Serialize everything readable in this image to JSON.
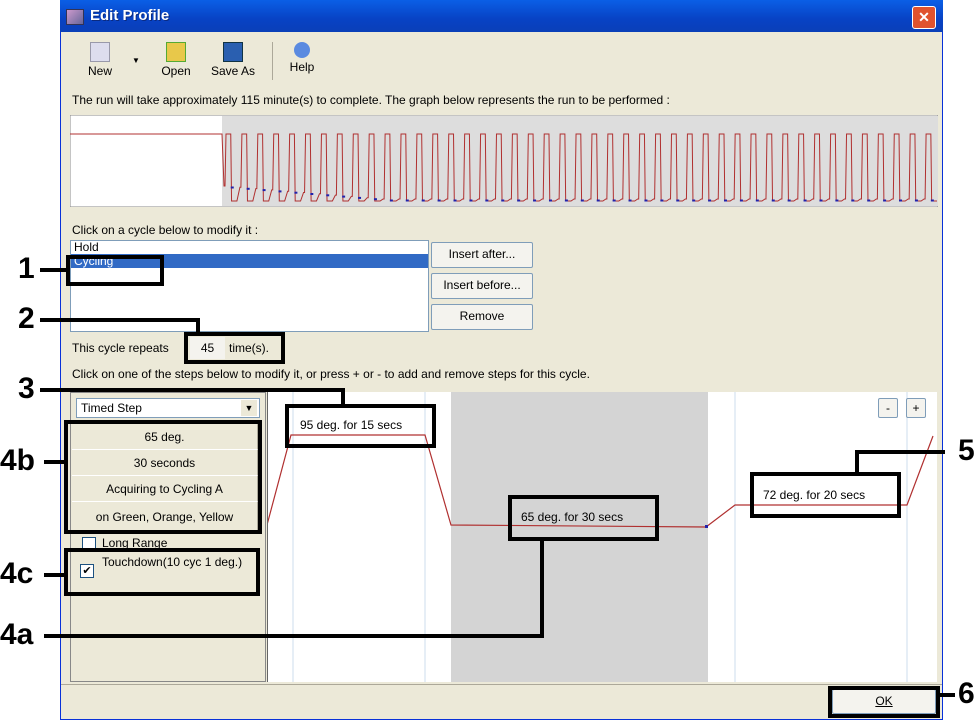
{
  "window": {
    "title": "Edit Profile",
    "close_icon": "close-icon"
  },
  "toolbar": {
    "new": "New",
    "open": "Open",
    "save_as": "Save As",
    "help": "Help"
  },
  "run_info": "The run will take approximately 115 minute(s) to complete. The graph below represents the run to be performed :",
  "cycles": {
    "label": "Click on a cycle below to modify it :",
    "items": [
      "Hold",
      "Cycling"
    ],
    "selected": "Cycling",
    "insert_after": "Insert after...",
    "insert_before": "Insert before...",
    "remove": "Remove"
  },
  "repeat": {
    "prefix": "This cycle repeats",
    "value": "45",
    "suffix": "time(s)."
  },
  "steps_instruction": "Click on one of the steps below to modify it, or press + or - to add and remove steps for this cycle.",
  "step_panel": {
    "type": "Timed Step",
    "temperature": "65 deg.",
    "duration": "30 seconds",
    "acquiring": "Acquiring to Cycling A",
    "channels": "on Green, Orange, Yellow",
    "long_range": {
      "label": "Long Range",
      "checked": false
    },
    "touchdown": {
      "label": "Touchdown(10 cyc 1 deg.)",
      "checked": true
    }
  },
  "steps": [
    {
      "label": "95 deg. for 15 secs"
    },
    {
      "label": "65 deg. for 30 secs"
    },
    {
      "label": "72 deg. for 20 secs"
    }
  ],
  "zoom": {
    "minus": "-",
    "plus": "+"
  },
  "ok": "OK",
  "annotations": [
    "1",
    "2",
    "3",
    "4b",
    "4c",
    "4a",
    "5",
    "6"
  ],
  "colors": {
    "titlebar": "#0842c4",
    "selection": "#316ac5",
    "curve": "#b03030",
    "window": "#ece9d8"
  }
}
